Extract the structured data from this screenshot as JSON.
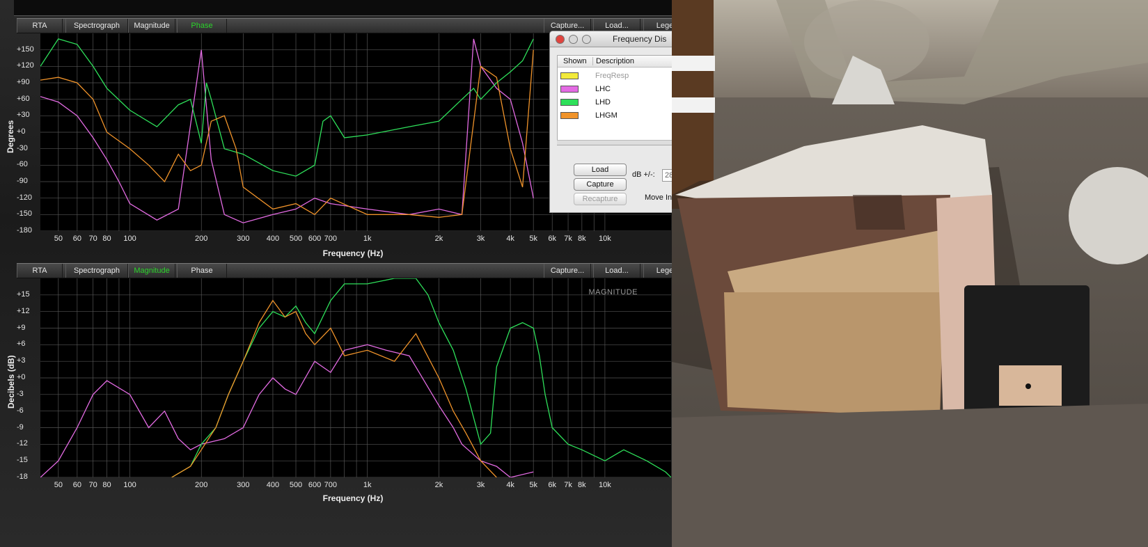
{
  "top_panel": {
    "tabs": [
      {
        "label": "RTA",
        "active": false
      },
      {
        "label": "Spectrograph",
        "active": false
      },
      {
        "label": "Magnitude",
        "active": false
      },
      {
        "label": "Phase",
        "active": true
      }
    ],
    "right_buttons": [
      "Capture...",
      "Load...",
      "Lege"
    ],
    "ylabel": "Degrees",
    "xlabel": "Frequency (Hz)",
    "yticks": [
      "+150",
      "+120",
      "+90",
      "+60",
      "+30",
      "+0",
      "-30",
      "-60",
      "-90",
      "-120",
      "-150",
      "-180"
    ],
    "xticks": [
      "50",
      "60",
      "70",
      "80",
      "100",
      "200",
      "300",
      "400",
      "500",
      "600",
      "700",
      "1k",
      "2k",
      "3k",
      "4k",
      "5k",
      "6k",
      "7k",
      "8k",
      "10k"
    ]
  },
  "bottom_panel": {
    "tabs": [
      {
        "label": "RTA",
        "active": false
      },
      {
        "label": "Spectrograph",
        "active": false
      },
      {
        "label": "Magnitude",
        "active": true
      },
      {
        "label": "Phase",
        "active": false
      }
    ],
    "right_buttons": [
      "Capture...",
      "Load...",
      "Lege"
    ],
    "ylabel": "Decibels (dB)",
    "xlabel": "Frequency (Hz)",
    "overlay": "MAGNITUDE",
    "yticks": [
      "+15",
      "+12",
      "+9",
      "+6",
      "+3",
      "+0",
      "-3",
      "-6",
      "-9",
      "-12",
      "-15",
      "-18"
    ],
    "xticks": [
      "50",
      "60",
      "70",
      "80",
      "100",
      "200",
      "300",
      "400",
      "500",
      "600",
      "700",
      "1k",
      "2k",
      "3k",
      "4k",
      "5k",
      "6k",
      "7k",
      "8k",
      "10k"
    ]
  },
  "dialog": {
    "title": "Frequency Dis",
    "columns": [
      "Shown",
      "Description"
    ],
    "traces": [
      {
        "name": "FreqResp",
        "color": "#f2ea3a",
        "dimmed": true
      },
      {
        "name": "LHC",
        "color": "#e36be3",
        "dimmed": false
      },
      {
        "name": "LHD",
        "color": "#2ee05a",
        "dimmed": false
      },
      {
        "name": "LHGM",
        "color": "#f0932a",
        "dimmed": false
      }
    ],
    "buttons": {
      "load": "Load",
      "capture": "Capture",
      "recapture": "Recapture"
    },
    "db_label": "dB +/-:",
    "db_value": "28",
    "move_label": "Move In"
  },
  "chart_data": [
    {
      "type": "line",
      "title": "",
      "xlabel": "Frequency (Hz)",
      "ylabel": "Degrees",
      "xscale": "log",
      "xlim": [
        42,
        19000
      ],
      "ylim": [
        -180,
        180
      ],
      "grid": true,
      "series": [
        {
          "name": "LHC",
          "color": "#e36be3",
          "x": [
            42,
            50,
            60,
            70,
            80,
            90,
            100,
            130,
            160,
            200,
            220,
            250,
            300,
            400,
            500,
            600,
            700,
            1000,
            1500,
            2000,
            2500,
            2800,
            3000,
            3500,
            4000,
            4500,
            5000
          ],
          "y": [
            65,
            55,
            30,
            -10,
            -50,
            -90,
            -130,
            -160,
            -140,
            150,
            -50,
            -150,
            -165,
            -150,
            -140,
            -120,
            -130,
            -140,
            -150,
            -140,
            -150,
            170,
            120,
            80,
            60,
            -20,
            -120
          ]
        },
        {
          "name": "LHD",
          "color": "#2ee05a",
          "x": [
            42,
            50,
            60,
            70,
            80,
            100,
            130,
            160,
            180,
            200,
            210,
            220,
            250,
            300,
            400,
            500,
            600,
            650,
            700,
            800,
            1000,
            1500,
            2000,
            2500,
            2800,
            3000,
            3500,
            4000,
            4500,
            5000
          ],
          "y": [
            120,
            170,
            160,
            120,
            80,
            40,
            10,
            50,
            60,
            -20,
            90,
            60,
            -30,
            -40,
            -70,
            -80,
            -60,
            20,
            30,
            -10,
            -5,
            10,
            20,
            60,
            80,
            60,
            90,
            110,
            130,
            170
          ]
        },
        {
          "name": "LHGM",
          "color": "#f0932a",
          "x": [
            42,
            50,
            60,
            70,
            80,
            100,
            120,
            140,
            160,
            180,
            200,
            220,
            250,
            280,
            300,
            400,
            500,
            600,
            700,
            1000,
            1500,
            2000,
            2500,
            3000,
            3500,
            4000,
            4500,
            5000
          ],
          "y": [
            95,
            100,
            90,
            60,
            0,
            -30,
            -60,
            -90,
            -40,
            -70,
            -60,
            20,
            30,
            -30,
            -100,
            -140,
            -130,
            -150,
            -120,
            -150,
            -150,
            -155,
            -150,
            120,
            100,
            -30,
            -100,
            150
          ]
        }
      ]
    },
    {
      "type": "line",
      "title": "",
      "xlabel": "Frequency (Hz)",
      "ylabel": "Decibels (dB)",
      "xscale": "log",
      "xlim": [
        42,
        19000
      ],
      "ylim": [
        -18,
        18
      ],
      "grid": true,
      "series": [
        {
          "name": "LHC",
          "color": "#e36be3",
          "x": [
            42,
            50,
            60,
            70,
            80,
            100,
            120,
            140,
            160,
            180,
            200,
            250,
            300,
            350,
            400,
            450,
            500,
            600,
            700,
            800,
            1000,
            1200,
            1500,
            2000,
            2300,
            2500,
            3000,
            3500,
            4000,
            5000
          ],
          "y": [
            -18,
            -15,
            -9,
            -3,
            -0.5,
            -3,
            -9,
            -6,
            -11,
            -13,
            -12,
            -11,
            -9,
            -3,
            0,
            -2,
            -3,
            3,
            1,
            5,
            6,
            5,
            4,
            -5,
            -9,
            -12,
            -15,
            -16,
            -18,
            -17
          ]
        },
        {
          "name": "LHD",
          "color": "#2ee05a",
          "x": [
            150,
            180,
            200,
            230,
            260,
            300,
            350,
            400,
            450,
            500,
            550,
            600,
            700,
            800,
            1000,
            1300,
            1600,
            1800,
            2000,
            2300,
            2600,
            3000,
            3300,
            3500,
            4000,
            4500,
            5000,
            5300,
            5600,
            6000,
            7000,
            8000,
            10000,
            12000,
            15000,
            18000,
            19000
          ],
          "y": [
            -18,
            -16,
            -12,
            -9,
            -3,
            3,
            9,
            12,
            11,
            13,
            10,
            8,
            14,
            17,
            17,
            18,
            18,
            15,
            10,
            5,
            -2,
            -12,
            -10,
            2,
            9,
            10,
            9,
            4,
            -3,
            -9,
            -12,
            -13,
            -15,
            -13,
            -15,
            -17,
            -18
          ]
        },
        {
          "name": "LHGM",
          "color": "#f0932a",
          "x": [
            150,
            180,
            200,
            230,
            260,
            300,
            350,
            400,
            450,
            500,
            550,
            600,
            700,
            800,
            1000,
            1300,
            1600,
            2000,
            2300,
            2600,
            3000,
            3500
          ],
          "y": [
            -18,
            -16,
            -13,
            -9,
            -3,
            3,
            10,
            14,
            11,
            12,
            8,
            6,
            9,
            4,
            5,
            3,
            8,
            0,
            -6,
            -10,
            -15,
            -18
          ]
        }
      ]
    }
  ]
}
